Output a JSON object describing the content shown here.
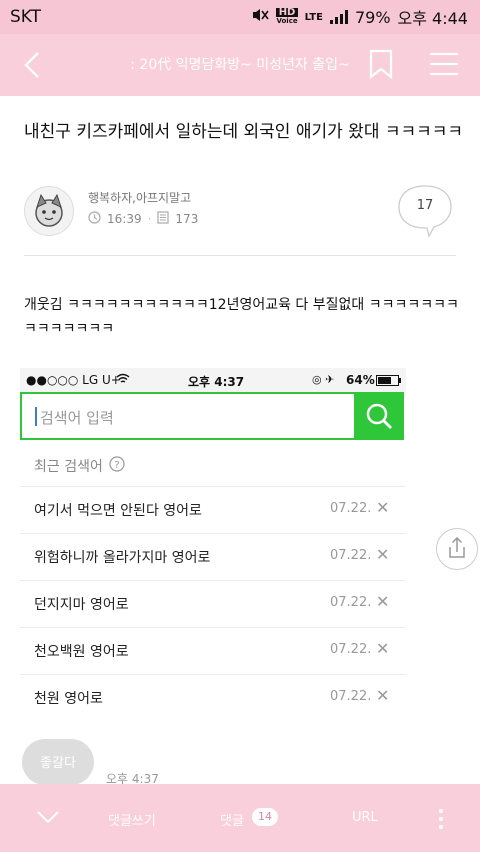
{
  "status_bar": {
    "carrier": "SKT",
    "hd_line1": "HD",
    "hd_line2": "Voice",
    "network": "LTE",
    "battery": "79%",
    "time": "오후 4:44"
  },
  "header": {
    "title": ": 20代 익명담화방~ 미성년자 출입~"
  },
  "post": {
    "title": "내친구 키즈카페에서 일하는데 외국인 애기가 왔대 ㅋㅋㅋㅋㅋ",
    "author": "행복하자,아프지말고",
    "time": "16:39",
    "views": "173",
    "comment_count": "17",
    "body": "개웃김 ㅋㅋㅋㅋㅋㅋㅋㅋㅋㅋㅋ12년영어교육 다 부질없대 ㅋㅋㅋㅋㅋㅋㅋㅋㅋㅋㅋㅋㅋㅋ"
  },
  "embedded_screenshot": {
    "carrier": "●●○○○ LG U+",
    "time": "오후 4:37",
    "battery": "64%",
    "search_placeholder": "검색어 입력",
    "recent_label": "최근 검색어",
    "recent_items": [
      {
        "text": "여기서 먹으면 안된다 영어로",
        "date": "07.22."
      },
      {
        "text": "위험하니까 올라가지마 영어로",
        "date": "07.22."
      },
      {
        "text": "던지지마 영어로",
        "date": "07.22."
      },
      {
        "text": "천오백원 영어로",
        "date": "07.22."
      },
      {
        "text": "천원 영어로",
        "date": "07.22."
      }
    ],
    "like_label": "좋갈다",
    "reply_time": "오후 4:37"
  },
  "bottom_bar": {
    "write_comment": "댓글쓰기",
    "comments_label": "댓글",
    "comments_count": "14",
    "url_label": "URL"
  },
  "colors": {
    "brand_pink": "#f9cfdb",
    "search_green": "#2fc63a"
  }
}
